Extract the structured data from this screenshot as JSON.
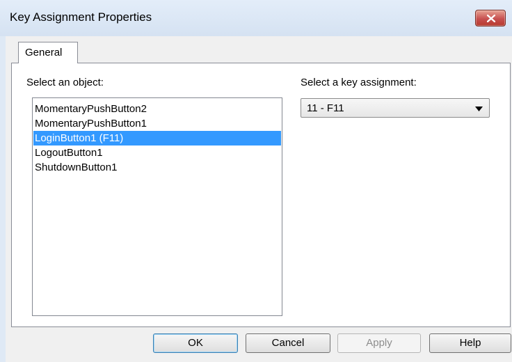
{
  "window": {
    "title": "Key Assignment Properties",
    "close_icon": "close-icon"
  },
  "tabs": [
    {
      "label": "General",
      "active": true
    }
  ],
  "object_list": {
    "label": "Select an object:",
    "items": [
      "MomentaryPushButton2",
      "MomentaryPushButton1",
      "LoginButton1 (F11)",
      "LogoutButton1",
      "ShutdownButton1"
    ],
    "selected_index": 2
  },
  "key_assignment": {
    "label": "Select a key assignment:",
    "value": "11 - F11",
    "arrow_icon": "dropdown-arrow-icon"
  },
  "buttons": {
    "ok": "OK",
    "cancel": "Cancel",
    "apply": "Apply",
    "help": "Help"
  },
  "colors": {
    "selection": "#3399ff",
    "close_button": "#c75050"
  }
}
